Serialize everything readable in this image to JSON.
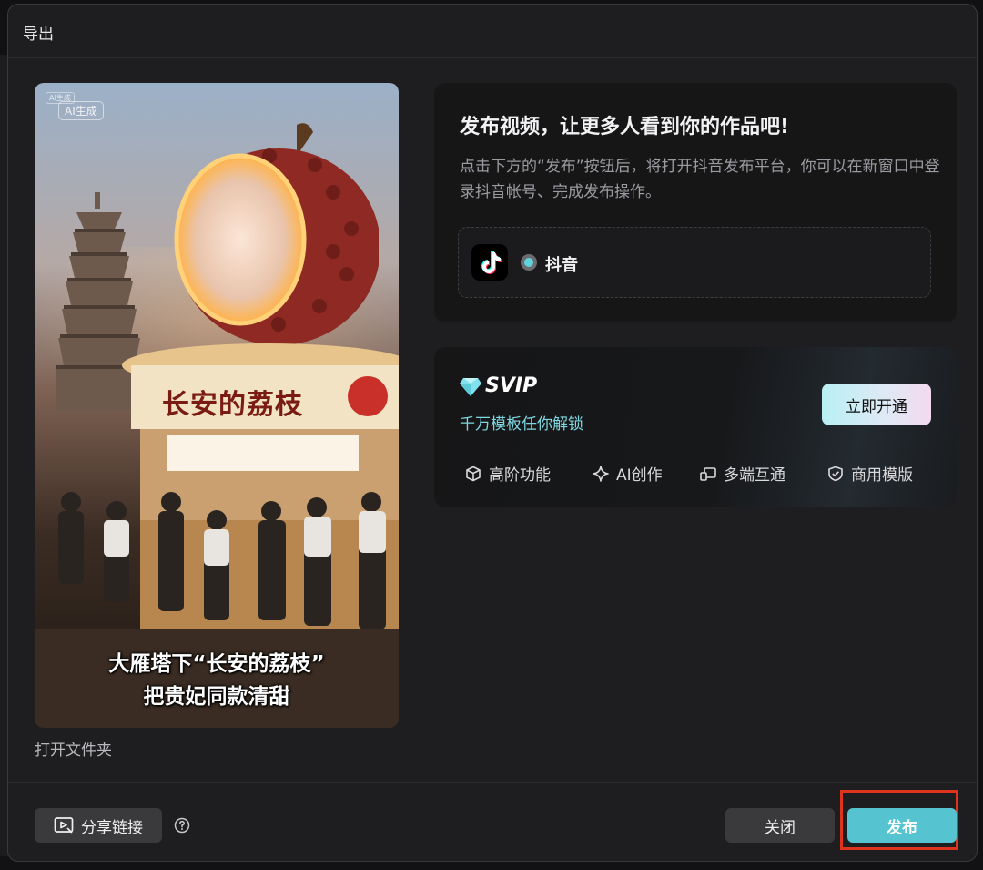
{
  "dialog": {
    "title": "导出"
  },
  "preview": {
    "ai_badge": "AI生成",
    "ai_badge_small": "AI生成",
    "sign_text": "长安的荔枝",
    "caption_line1": "大雁塔下“长安的荔枝”",
    "caption_line2": "把贵妃同款清甜",
    "open_folder": "打开文件夹"
  },
  "publish": {
    "heading": "发布视频，让更多人看到你的作品吧!",
    "description": "点击下方的“发布”按钮后，将打开抖音发布平台，你可以在新窗口中登录抖音帐号、完成发布操作。",
    "platform": {
      "label": "抖音",
      "selected": true,
      "icon": "douyin-logo-icon"
    }
  },
  "svip": {
    "title": "SVIP",
    "subtitle": "千万模板任你解锁",
    "button": "立即开通",
    "features": [
      {
        "label": "高阶功能",
        "icon": "cube-icon"
      },
      {
        "label": "AI创作",
        "icon": "sparkle-icon"
      },
      {
        "label": "多端互通",
        "icon": "devices-icon"
      },
      {
        "label": "商用模版",
        "icon": "shield-check-icon"
      }
    ]
  },
  "footer": {
    "share_label": "分享链接",
    "close_label": "关闭",
    "publish_label": "发布"
  },
  "colors": {
    "accent": "#55c4d0",
    "highlight_border": "#e0331e",
    "dialog_bg": "#1e1e20",
    "panel_bg": "#161617"
  }
}
